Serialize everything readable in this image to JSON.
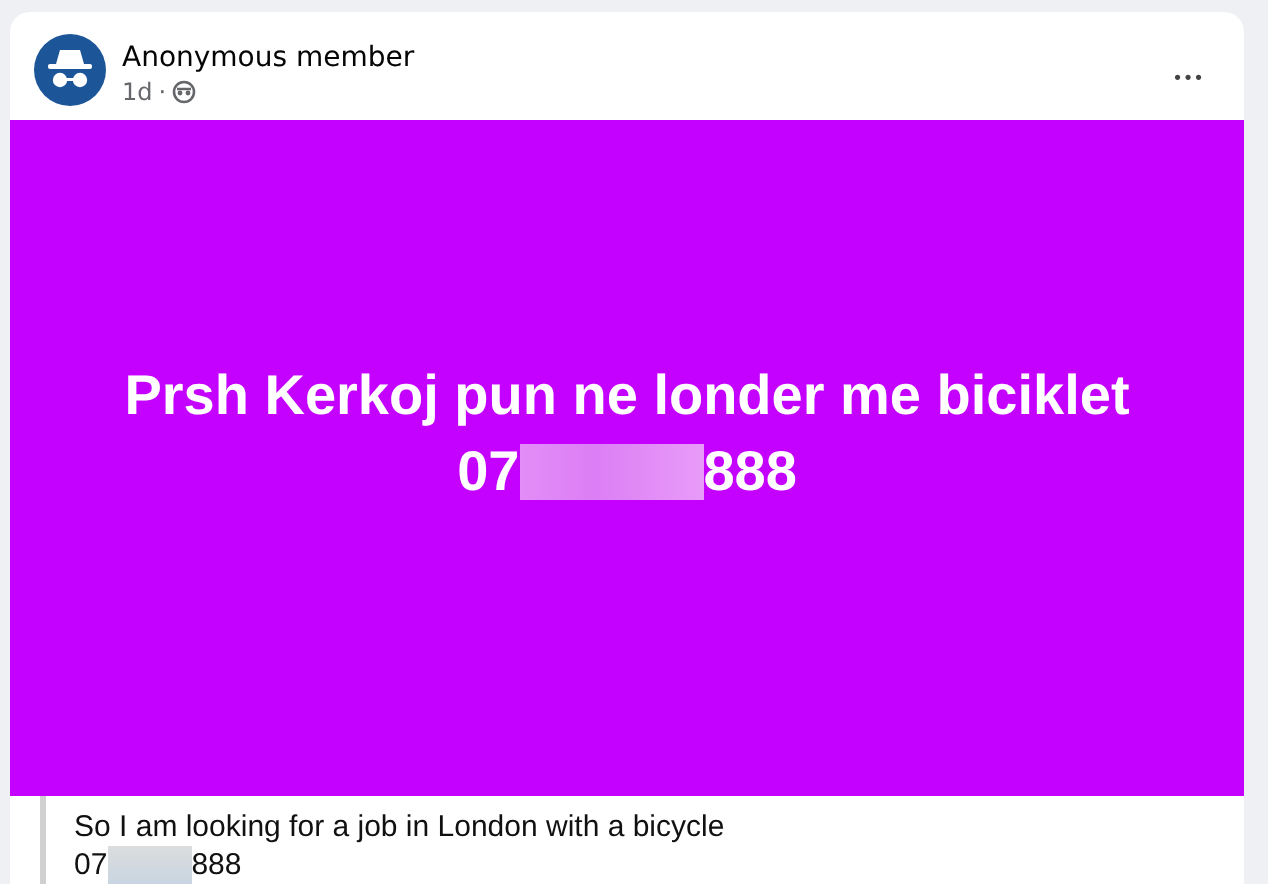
{
  "post": {
    "author": "Anonymous member",
    "time": "1d",
    "separator": "·",
    "more": "•••",
    "banner": {
      "color": "#c400ff",
      "line": "Prsh Kerkoj pun ne londer me biciklet",
      "phone": {
        "prefix": "07",
        "suffix": "888"
      }
    }
  },
  "translation": {
    "line": "So I am looking for a job in London with a bicycle",
    "phone": {
      "prefix": "07",
      "suffix": "888"
    }
  }
}
